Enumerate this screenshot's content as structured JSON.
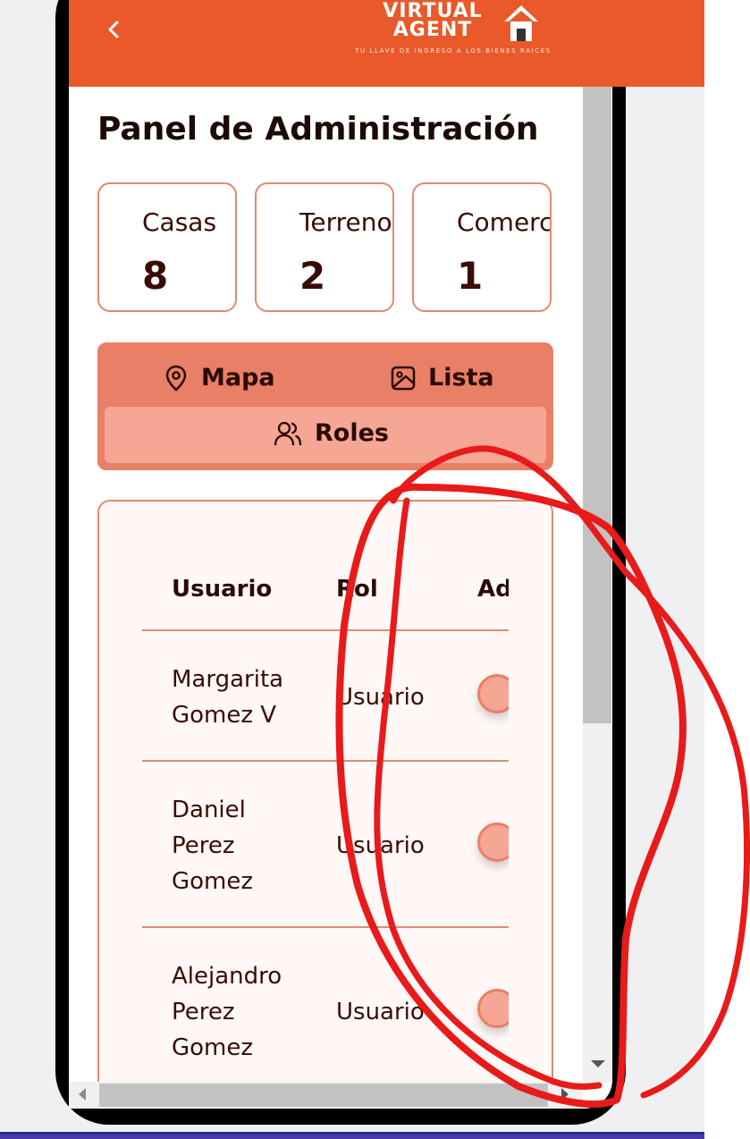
{
  "header": {
    "logo_main": "VIRTUAL AGENT",
    "logo_tagline": "TU LLAVE DE INGRESO A LOS BIENES RAÍCES"
  },
  "page_title": "Panel de Administración",
  "stats": [
    {
      "label": "Casas",
      "value": "8"
    },
    {
      "label": "Terrenos",
      "value": "2"
    },
    {
      "label": "Comercial",
      "value": "1"
    }
  ],
  "tabs": {
    "map_label": "Mapa",
    "list_label": "Lista",
    "roles_label": "Roles",
    "active": "Roles"
  },
  "table": {
    "headers": [
      "Usuario",
      "Rol",
      "Ad"
    ],
    "rows": [
      {
        "name": "Margarita Gomez V",
        "name_lines": [
          "Margarita",
          "Gomez V"
        ],
        "role": "Usuario"
      },
      {
        "name": "Daniel Perez Gomez",
        "name_lines": [
          "Daniel",
          "Perez",
          "Gomez"
        ],
        "role": "Usuario"
      },
      {
        "name": "Alejandro Perez Gomez",
        "name_lines": [
          "Alejandro",
          "Perez",
          "Gomez"
        ],
        "role": "Usuario"
      }
    ]
  },
  "colors": {
    "brand": "#e9592a",
    "accent": "#e97f66",
    "accent_light": "#f5a694",
    "annotation": "#e81a1a"
  }
}
